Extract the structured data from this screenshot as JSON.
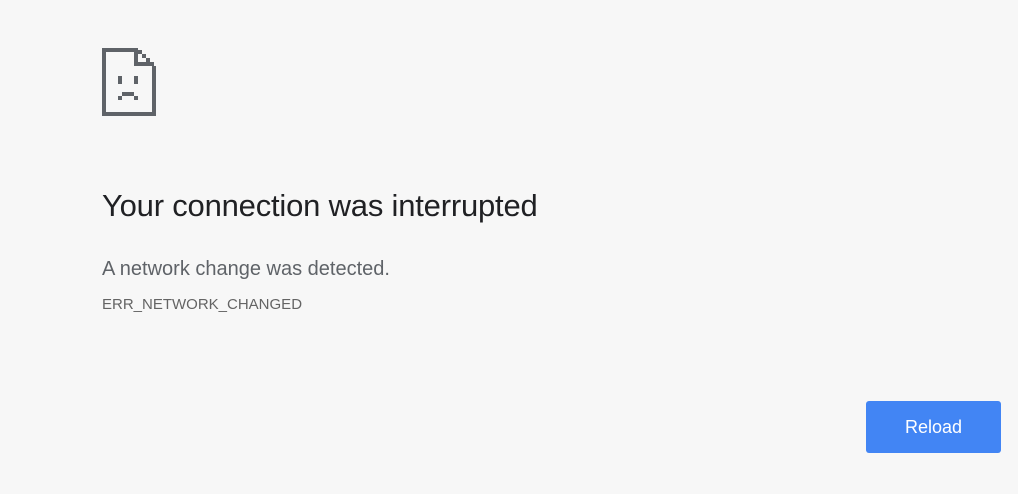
{
  "error_page": {
    "icon": "sad-document-icon",
    "heading": "Your connection was interrupted",
    "message": "A network change was detected.",
    "error_code": "ERR_NETWORK_CHANGED",
    "reload_label": "Reload"
  },
  "colors": {
    "background": "#f7f7f7",
    "heading": "#202124",
    "message": "#5f6368",
    "button": "#4285f4",
    "button_text": "#ffffff"
  }
}
